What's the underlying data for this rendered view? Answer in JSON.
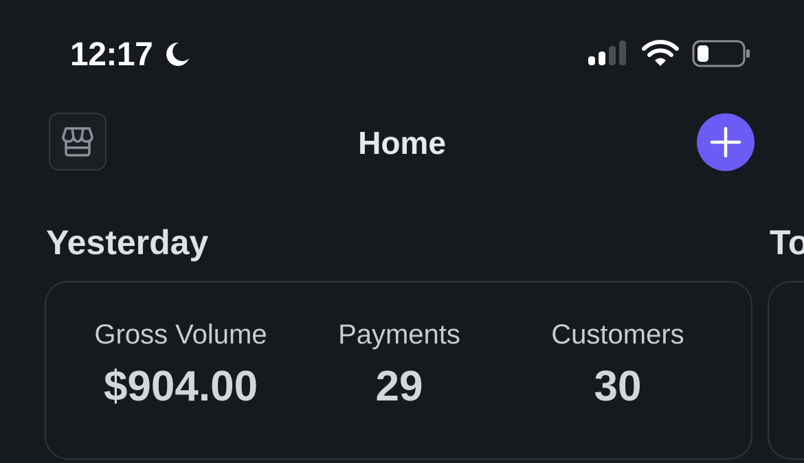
{
  "status_bar": {
    "time": "12:17",
    "focus_icon": "moon-icon",
    "signal_icon": "cellular-signal-icon",
    "wifi_icon": "wifi-icon",
    "battery_icon": "battery-low-icon"
  },
  "nav": {
    "title": "Home",
    "left_button_icon": "storefront-icon",
    "right_button_icon": "plus-icon"
  },
  "sections": [
    {
      "heading": "Yesterday",
      "stats": [
        {
          "label": "Gross Volume",
          "value": "$904.00"
        },
        {
          "label": "Payments",
          "value": "29"
        },
        {
          "label": "Customers",
          "value": "30"
        }
      ]
    },
    {
      "heading": "To"
    }
  ],
  "colors": {
    "background": "#16191e",
    "accent": "#6b5cf6",
    "card_border": "#30343b",
    "primary_text": "#e6e8ec",
    "secondary_text": "#c9ccd2"
  }
}
